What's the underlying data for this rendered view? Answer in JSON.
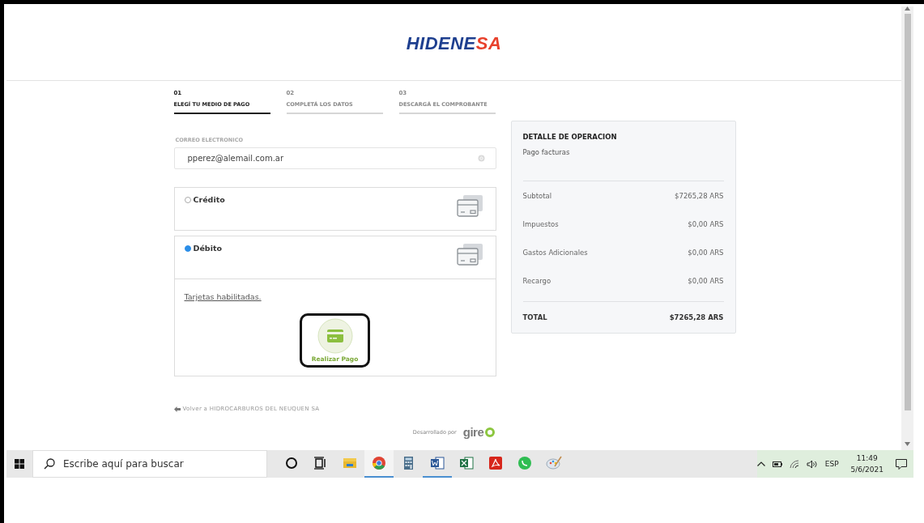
{
  "logo": {
    "parts": [
      {
        "text": "HIDENE",
        "color": "#1e3f8f"
      },
      {
        "text": "SA",
        "color": "#e8412c"
      }
    ]
  },
  "steps": [
    {
      "number": "01",
      "label": "ELEGÍ TU MEDIO DE PAGO",
      "selected": true
    },
    {
      "number": "02",
      "label": "COMPLETÁ LOS DATOS",
      "selected": false
    },
    {
      "number": "03",
      "label": "DESCARGÁ EL COMPROBANTE",
      "selected": false
    }
  ],
  "email": {
    "label": "CORREO ELECTRONICO",
    "value": "pperez@alemail.com.ar"
  },
  "payment_options": [
    {
      "label": "Crédito",
      "selected": false
    },
    {
      "label": "Débito",
      "selected": true,
      "link": "Tarjetas habilitadas.",
      "button": "Realizar Pago"
    }
  ],
  "back_link": "Volver a HIDROCARBUROS DEL NEUQUEN SA",
  "credit": {
    "text": "Desarrollado por",
    "brand": "gire"
  },
  "detail": {
    "title": "DETALLE DE OPERACION",
    "description": "Pago facturas",
    "rows": [
      {
        "label": "Subtotal",
        "value": "$7265,28 ARS"
      },
      {
        "label": "Impuestos",
        "value": "$0,00 ARS"
      },
      {
        "label": "Gastos Adicionales",
        "value": "$0,00 ARS"
      },
      {
        "label": "Recargo",
        "value": "$0,00 ARS"
      }
    ],
    "total": {
      "label": "TOTAL",
      "value": "$7265,28 ARS"
    }
  },
  "taskbar": {
    "search_placeholder": "Escribe aquí para buscar",
    "apps": [
      {
        "kind": "cortana",
        "open": false,
        "selected": false
      },
      {
        "kind": "taskview",
        "open": false,
        "selected": false
      },
      {
        "kind": "folder",
        "open": false,
        "selected": false
      },
      {
        "kind": "browser",
        "open": true,
        "selected": true
      },
      {
        "kind": "calculator",
        "open": false,
        "selected": false
      },
      {
        "kind": "word",
        "open": true,
        "selected": false
      },
      {
        "kind": "excel",
        "open": false,
        "selected": false
      },
      {
        "kind": "pdf",
        "open": false,
        "selected": false
      },
      {
        "kind": "chat",
        "open": false,
        "selected": false
      },
      {
        "kind": "paint",
        "open": false,
        "selected": false
      }
    ],
    "language": "ESP",
    "time": "11:49",
    "date": "5/6/2021"
  }
}
